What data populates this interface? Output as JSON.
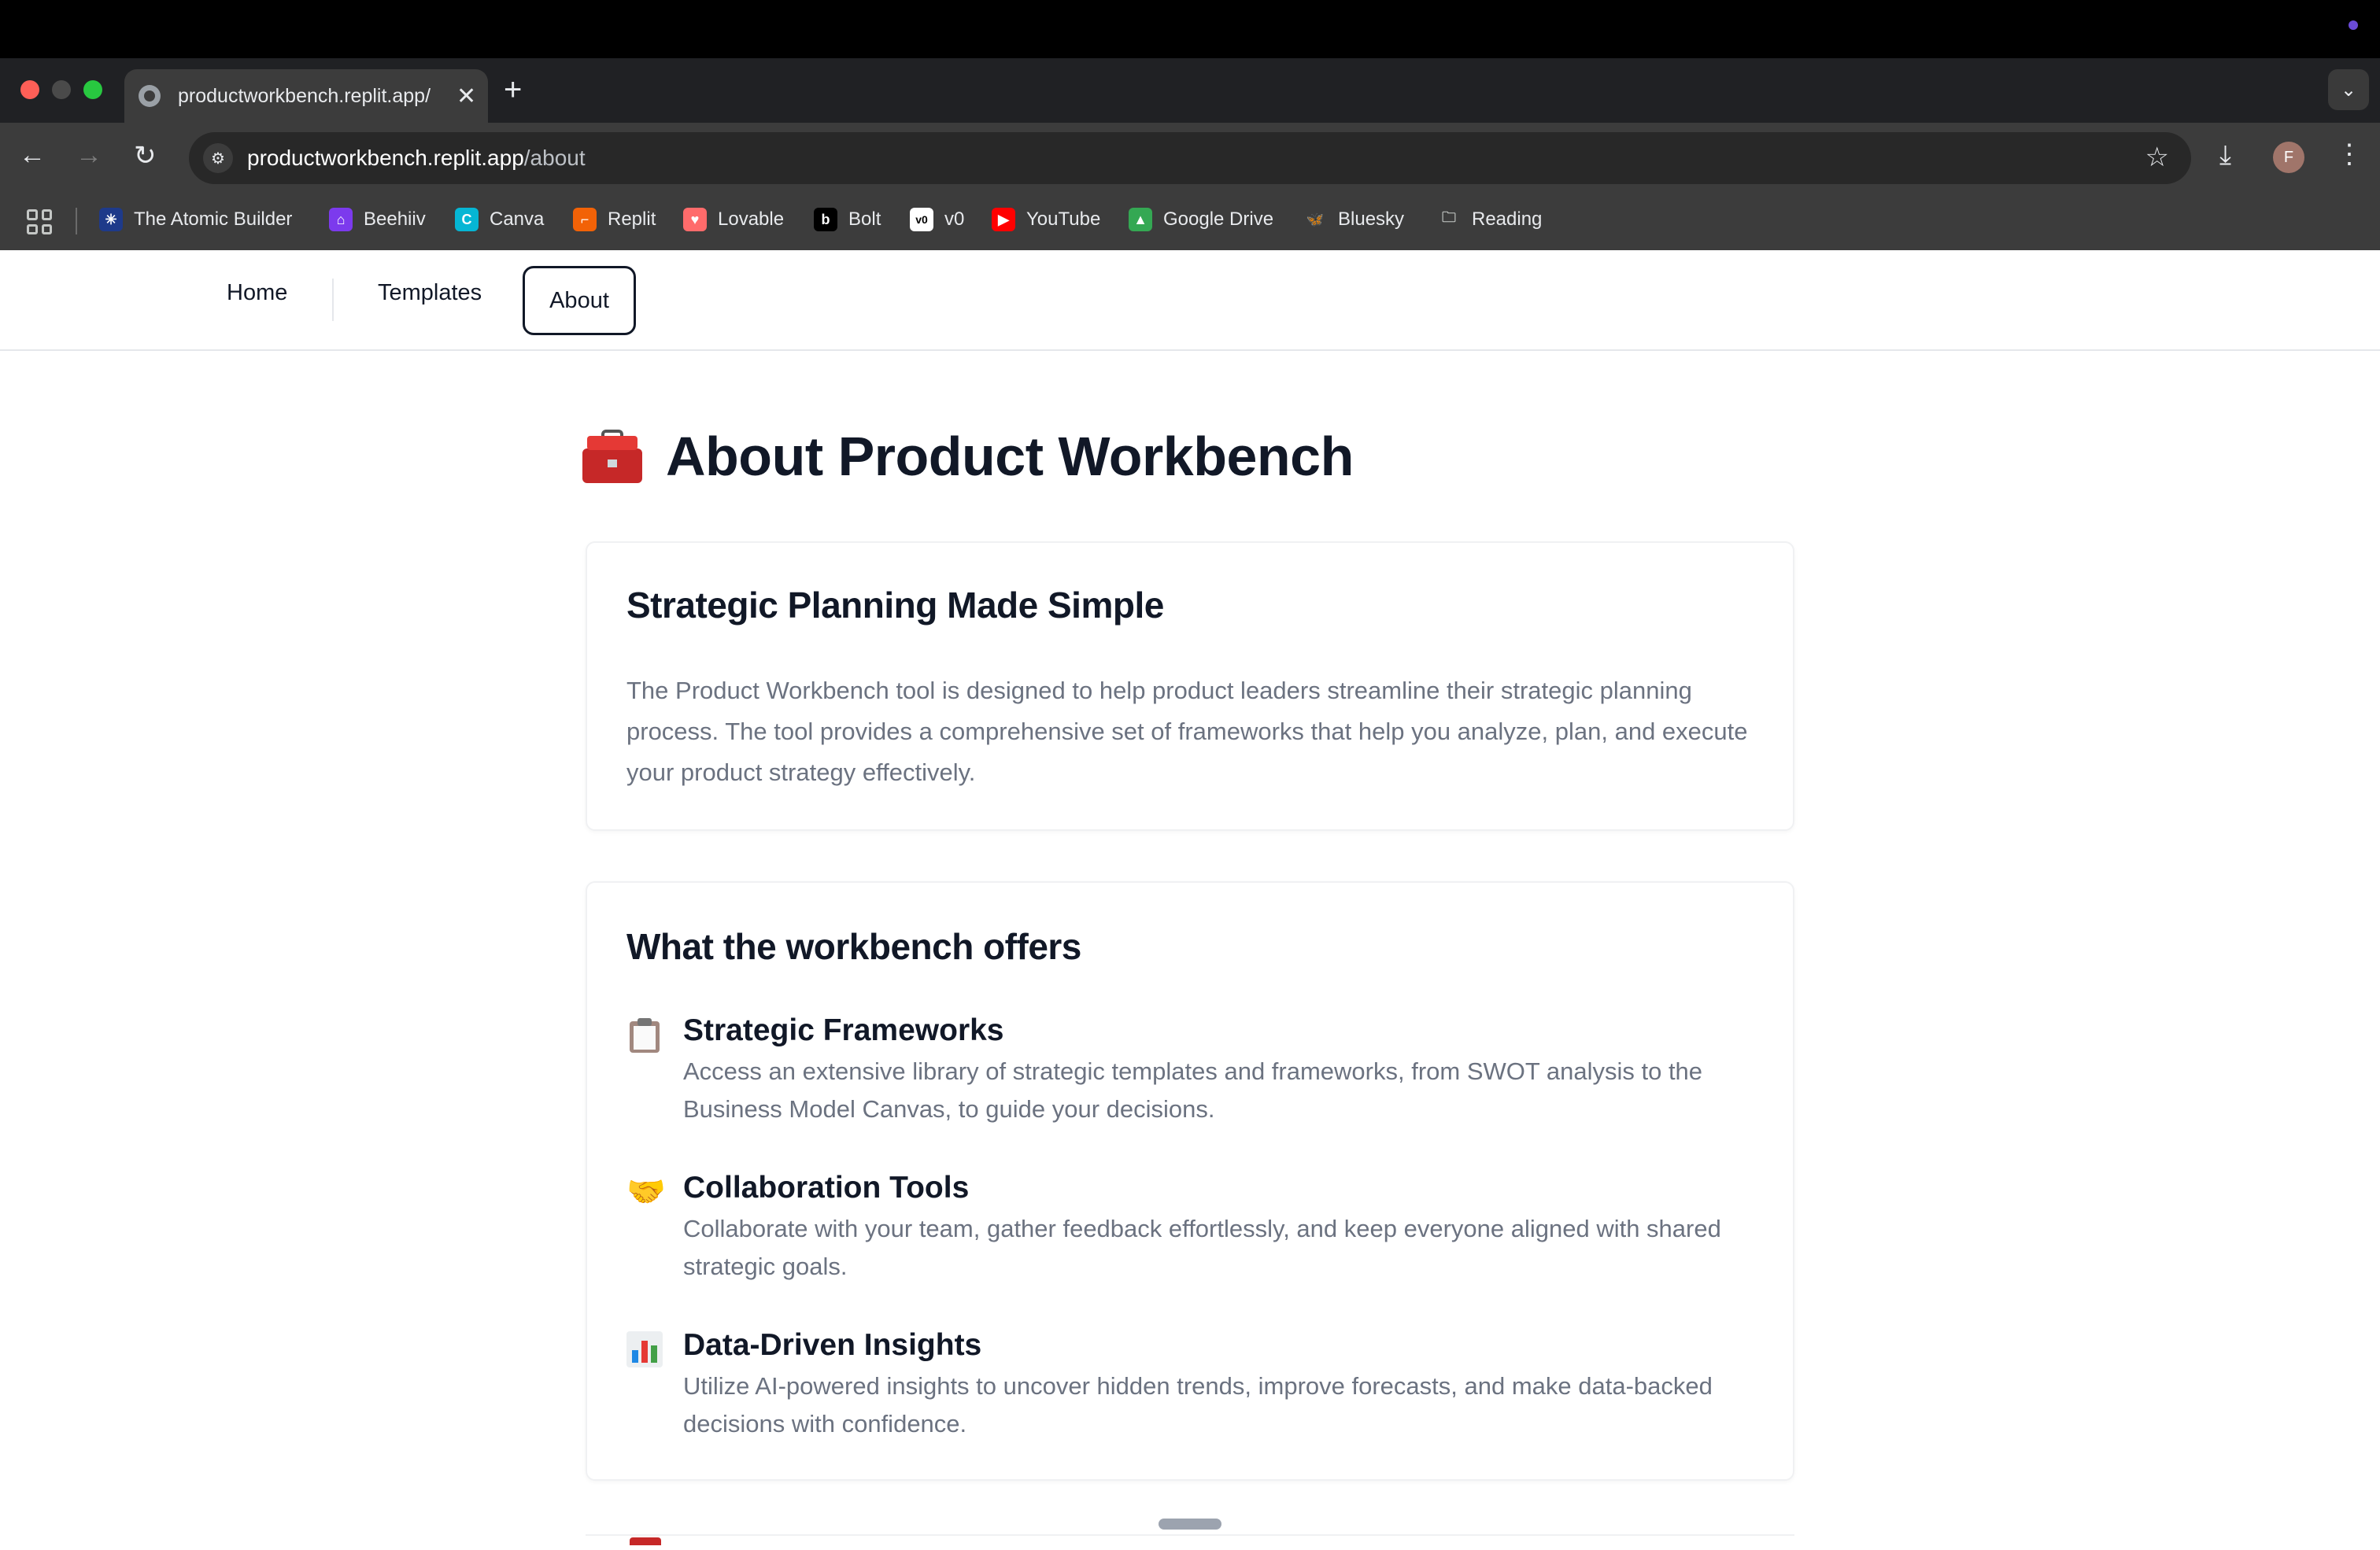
{
  "browser": {
    "tab_title": "productworkbench.replit.app/",
    "tab_close": "✕",
    "new_tab": "+",
    "tab_search": "⌄",
    "url_host": "productworkbench.replit.app",
    "url_path": "/about",
    "avatar_letter": "F",
    "icons": {
      "back": "←",
      "forward": "→",
      "reload": "↻",
      "site_settings": "⚙",
      "star": "☆",
      "download": "⤓",
      "menu": "⋮"
    }
  },
  "bookmarks": [
    {
      "label": "The Atomic Builder",
      "icon": "atomic-builder-icon",
      "color": "#1e3a8a",
      "glyph": "✳"
    },
    {
      "label": "Beehiiv",
      "icon": "beehiiv-icon",
      "color": "#7c3aed",
      "glyph": "⌂"
    },
    {
      "label": "Canva",
      "icon": "canva-icon",
      "color": "#06b6d4",
      "glyph": "C"
    },
    {
      "label": "Replit",
      "icon": "replit-icon",
      "color": "#f26207",
      "glyph": "⌐"
    },
    {
      "label": "Lovable",
      "icon": "lovable-icon",
      "color": "#ff6b6b",
      "glyph": "♥"
    },
    {
      "label": "Bolt",
      "icon": "bolt-icon",
      "color": "#000000",
      "glyph": "b"
    },
    {
      "label": "v0",
      "icon": "v0-icon",
      "color": "#ffffff",
      "glyph": "v0"
    },
    {
      "label": "YouTube",
      "icon": "youtube-icon",
      "color": "#ff0000",
      "glyph": "▶"
    },
    {
      "label": "Google Drive",
      "icon": "google-drive-icon",
      "color": "#34a853",
      "glyph": "▲"
    },
    {
      "label": "Bluesky",
      "icon": "bluesky-icon",
      "color": "#1185fe",
      "glyph": "🦋"
    },
    {
      "label": "Reading",
      "icon": "folder-icon",
      "color": "#c4c7c5",
      "glyph": "🗀"
    }
  ],
  "nav": {
    "home": "Home",
    "templates": "Templates",
    "about": "About"
  },
  "page": {
    "title": "About Product Workbench",
    "intro": {
      "heading": "Strategic Planning Made Simple",
      "body": "The Product Workbench tool is designed to help product leaders streamline their strategic planning process. The tool provides a comprehensive set of frameworks that help you analyze, plan, and execute your product strategy effectively."
    },
    "offers": {
      "heading": "What the workbench offers",
      "features": [
        {
          "icon": "clipboard-icon",
          "title": "Strategic Frameworks",
          "body": "Access an extensive library of strategic templates and frameworks, from SWOT analysis to the Business Model Canvas, to guide your decisions."
        },
        {
          "icon": "handshake-icon",
          "glyph": "🤝",
          "title": "Collaboration Tools",
          "body": "Collaborate with your team, gather feedback effortlessly, and keep everyone aligned with shared strategic goals."
        },
        {
          "icon": "bar-chart-icon",
          "title": "Data-Driven Insights",
          "body": "Utilize AI-powered insights to uncover hidden trends, improve forecasts, and make data-backed decisions with confidence."
        }
      ]
    }
  }
}
